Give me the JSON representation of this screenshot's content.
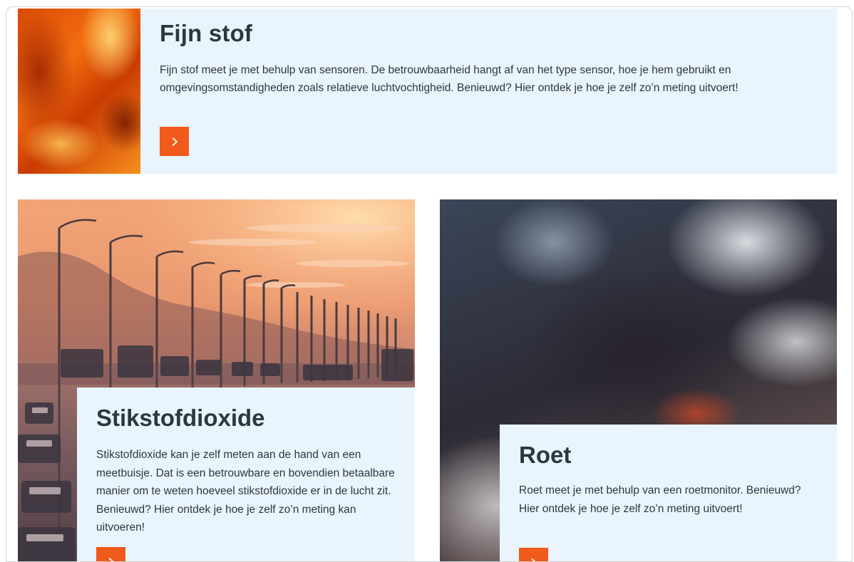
{
  "cards": [
    {
      "title": "Fijn stof",
      "text": "Fijn stof meet je met behulp van sensoren. De betrouwbaarheid hangt af van het type sensor, hoe je hem gebruikt en omgevingsomstandigheden zoals relatieve luchtvochtigheid. Benieuwd? Hier ontdek je hoe je zelf zo’n meting uitvoert!",
      "button_icon": "chevron-right-icon"
    },
    {
      "title": "Stikstofdioxide",
      "text": "Stikstofdioxide kan je zelf meten aan de hand van een meetbuisje. Dat is een betrouwbare en bovendien betaalbare manier om te weten hoeveel stikstofdioxide er in de lucht zit. Benieuwd? Hier ontdek je hoe je zelf zo’n meting kan uitvoeren!",
      "button_icon": "chevron-right-icon"
    },
    {
      "title": "Roet",
      "text": "Roet meet je met behulp van een roetmonitor. Benieuwd? Hier ontdek je hoe je zelf zo’n meting uitvoert!",
      "button_icon": "chevron-right-icon"
    }
  ],
  "colors": {
    "accent": "#f05a1a",
    "panel_bg": "#e9f4fd",
    "text": "#2d383c"
  }
}
